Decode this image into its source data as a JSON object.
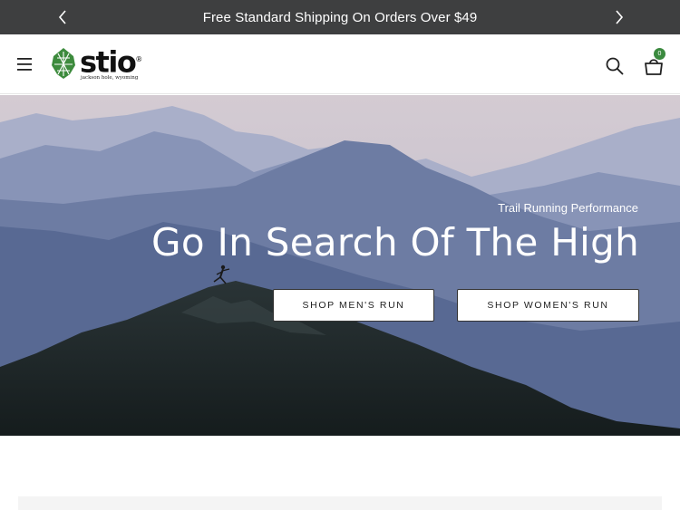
{
  "announcement": {
    "message": "Free Standard Shipping On Orders Over $49",
    "prev_icon": "chevron-left-icon",
    "next_icon": "chevron-right-icon"
  },
  "header": {
    "menu_icon": "hamburger-icon",
    "logo": {
      "wordmark": "stio",
      "registered": "®",
      "tagline": "jackson hole, wyoming",
      "mark_color": "#3d8b3d"
    },
    "search_icon": "search-icon",
    "cart_icon": "shopping-bag-icon",
    "cart_count": "0",
    "badge_color": "#3b8a3f"
  },
  "hero": {
    "eyebrow": "Trail Running Performance",
    "headline": "Go In Search Of The High",
    "buttons": [
      {
        "label": "SHOP MEN'S RUN"
      },
      {
        "label": "SHOP WOMEN'S RUN"
      }
    ]
  },
  "colors": {
    "announcement_bg": "#3e3f40",
    "hero_sky": "#c9bfc8",
    "hero_mountains": "#5a6f9a",
    "hero_foreground": "#1f2a2c"
  }
}
